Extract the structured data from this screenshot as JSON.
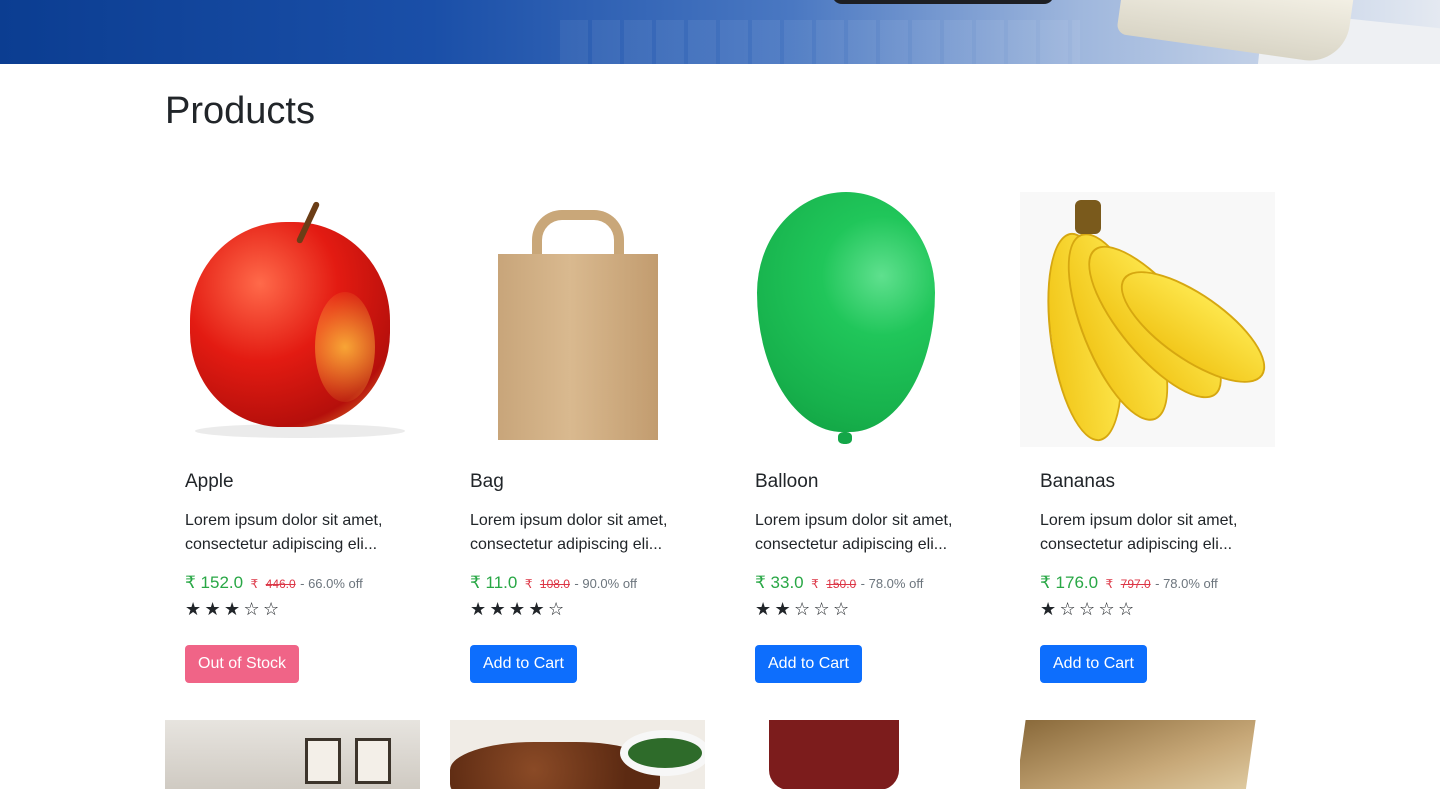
{
  "page": {
    "title": "Products"
  },
  "colors": {
    "price": "#28a745",
    "old_price": "#dc3545",
    "primary_button": "#0d6efd",
    "out_of_stock_button": "#f06487"
  },
  "products": [
    {
      "name": "Apple",
      "description": "Lorem ipsum dolor sit amet, consectetur adipiscing eli...",
      "price": "₹ 152.0",
      "old_price_symbol": "₹",
      "old_price": "446.0",
      "discount": "- 66.0% off",
      "rating": 3,
      "max_rating": 5,
      "button": "Out of Stock",
      "in_stock": false
    },
    {
      "name": "Bag",
      "description": "Lorem ipsum dolor sit amet, consectetur adipiscing eli...",
      "price": "₹ 11.0",
      "old_price_symbol": "₹",
      "old_price": "108.0",
      "discount": "- 90.0% off",
      "rating": 4,
      "max_rating": 5,
      "button": "Add to Cart",
      "in_stock": true
    },
    {
      "name": "Balloon",
      "description": "Lorem ipsum dolor sit amet, consectetur adipiscing eli...",
      "price": "₹ 33.0",
      "old_price_symbol": "₹",
      "old_price": "150.0",
      "discount": "- 78.0% off",
      "rating": 2,
      "max_rating": 5,
      "button": "Add to Cart",
      "in_stock": true
    },
    {
      "name": "Bananas",
      "description": "Lorem ipsum dolor sit amet, consectetur adipiscing eli...",
      "price": "₹ 176.0",
      "old_price_symbol": "₹",
      "old_price": "797.0",
      "discount": "- 78.0% off",
      "rating": 1,
      "max_rating": 5,
      "button": "Add to Cart",
      "in_stock": true
    }
  ]
}
